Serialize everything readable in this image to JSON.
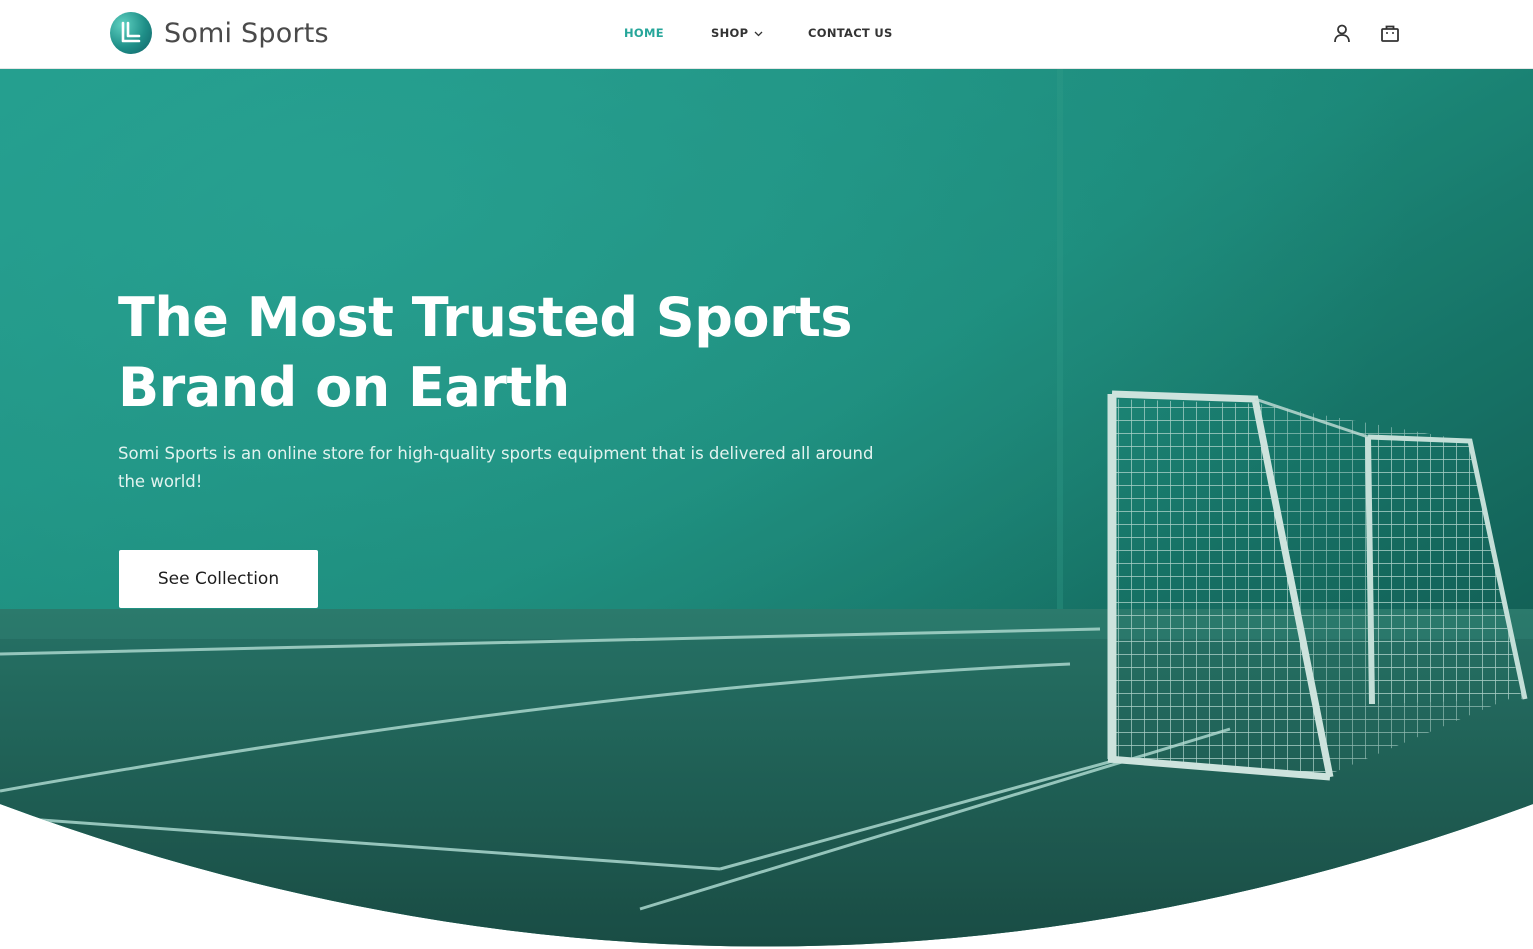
{
  "brand": {
    "name": "Somi Sports",
    "logo_icon": "somi-sports-logo-icon",
    "accent_color": "#26a69a"
  },
  "nav": {
    "home": "HOME",
    "shop": "SHOP",
    "contact": "CONTACT US",
    "active": "HOME"
  },
  "header_icons": {
    "account": "user-icon",
    "cart": "shopping-bag-icon"
  },
  "hero": {
    "title_line1": "The Most Trusted Sports",
    "title_line2": "Brand on Earth",
    "description": "Somi Sports is an online store for high-quality sports equipment that is delivered all around the world!",
    "cta_label": "See Collection",
    "background_image": "soccer-goal-on-field-teal-tint",
    "tint_color": "#1f8f80"
  }
}
